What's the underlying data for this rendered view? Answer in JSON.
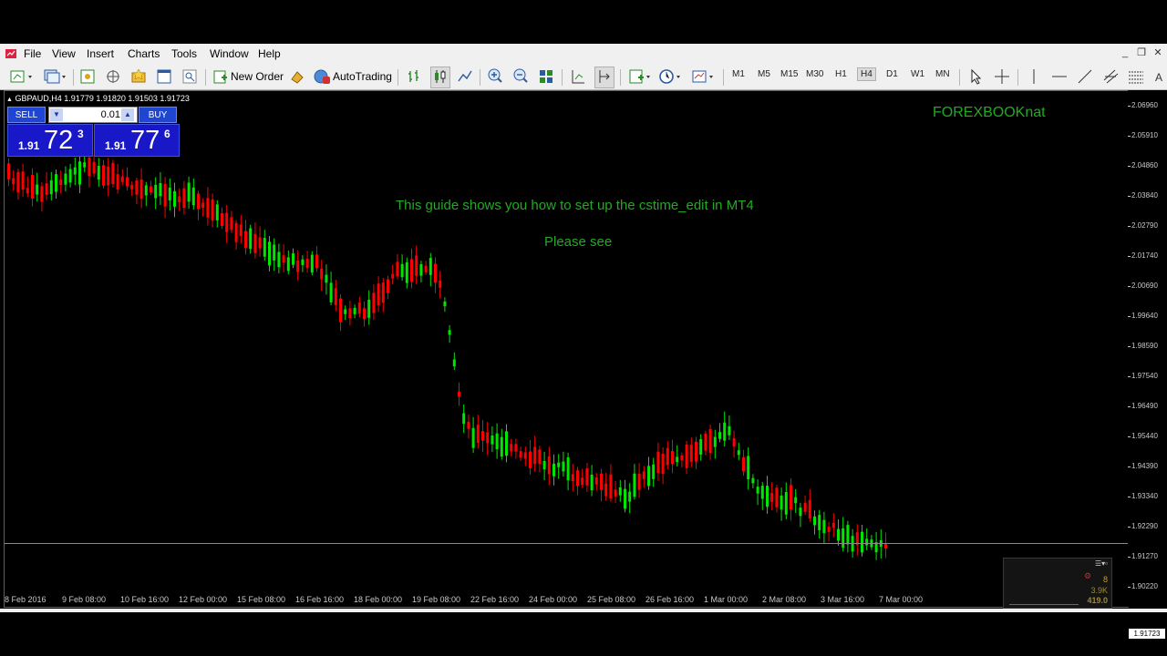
{
  "menu": {
    "items": [
      "File",
      "View",
      "Insert",
      "Charts",
      "Tools",
      "Window",
      "Help"
    ]
  },
  "toolbar": {
    "new_order_label": "New Order",
    "autotrading_label": "AutoTrading",
    "timeframes": [
      "M1",
      "M5",
      "M15",
      "M30",
      "H1",
      "H4",
      "D1",
      "W1",
      "MN"
    ],
    "active_timeframe": "H4"
  },
  "chart": {
    "symbol_header": "GBPAUD,H4  1.91779 1.91820 1.91503 1.91723",
    "brand_text": "FOREXBOOKnat",
    "guide_text": "This guide shows you how to set up the cstime_edit in MT4",
    "please_text": "Please see",
    "current_price": "1.91723",
    "bull_color": "#00e600",
    "bear_color": "#ff0000",
    "price_axis": [
      "2.06960",
      "2.05910",
      "2.04860",
      "2.03840",
      "2.02790",
      "2.01740",
      "2.00690",
      "1.99640",
      "1.98590",
      "1.97540",
      "1.96490",
      "1.95440",
      "1.94390",
      "1.93340",
      "1.92290",
      "1.91270",
      "1.90220"
    ],
    "time_axis": [
      "8 Feb 2016",
      "9 Feb 08:00",
      "10 Feb 16:00",
      "12 Feb 00:00",
      "15 Feb 08:00",
      "16 Feb 16:00",
      "18 Feb 00:00",
      "19 Feb 08:00",
      "22 Feb 16:00",
      "24 Feb 00:00",
      "25 Feb 08:00",
      "26 Feb 16:00",
      "1 Mar 00:00",
      "2 Mar 08:00",
      "3 Mar 16:00",
      "7 Mar 00:00"
    ]
  },
  "trade_panel": {
    "sell_label": "SELL",
    "buy_label": "BUY",
    "lot": "0.01",
    "sell_small": "1.91",
    "sell_big": "72",
    "sell_sup": "3",
    "buy_small": "1.91",
    "buy_big": "77",
    "buy_sup": "6"
  },
  "mini_panel": {
    "val_a": "8",
    "val_b": "3.9K",
    "val_c": "419.0"
  }
}
